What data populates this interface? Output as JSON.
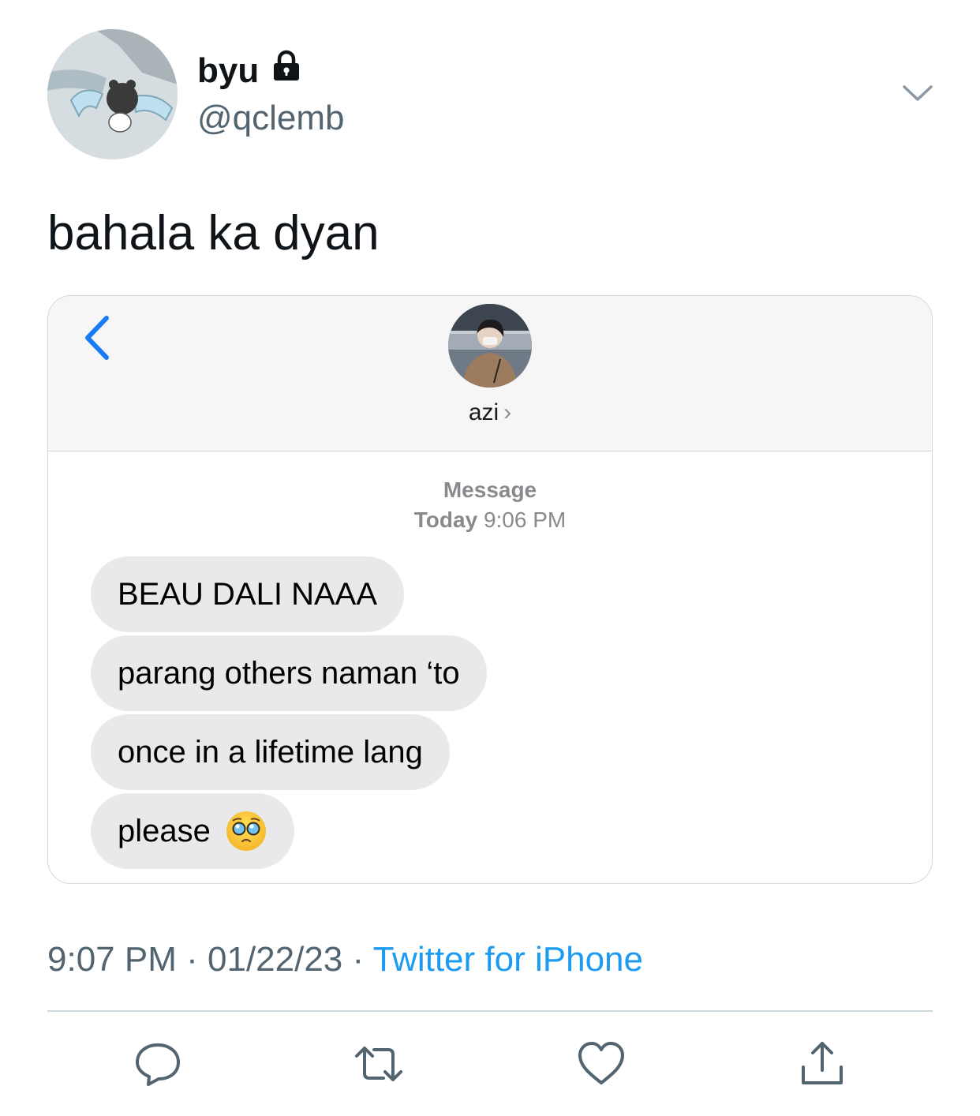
{
  "tweet": {
    "author": {
      "display_name": "byu",
      "handle": "@qclemb",
      "protected_icon": "lock-icon",
      "avatar_icon": "profile-avatar"
    },
    "text": "bahala ka dyan",
    "more_icon": "chevron-down-icon"
  },
  "imessage": {
    "back_icon": "chevron-left-icon",
    "contact_name": "azi",
    "contact_chevron": "›",
    "service_label": "Message",
    "time_day": "Today",
    "time_clock": "9:06 PM",
    "messages": [
      {
        "text": "BEAU DALI NAAA"
      },
      {
        "text": "parang others naman ‘to"
      },
      {
        "text": "once in a lifetime lang"
      },
      {
        "text": "please",
        "emoji": "pleading-face-emoji"
      }
    ],
    "colors": {
      "bubble": "#e9e9eb",
      "accent": "#1a7cf5"
    }
  },
  "footer": {
    "time": "9:07 PM",
    "date": "01/22/23",
    "separator": "·",
    "source": "Twitter for iPhone",
    "actions": [
      "reply-icon",
      "retweet-icon",
      "like-icon",
      "share-icon"
    ]
  },
  "colors": {
    "link": "#1d9bf0",
    "secondary": "#536471"
  }
}
